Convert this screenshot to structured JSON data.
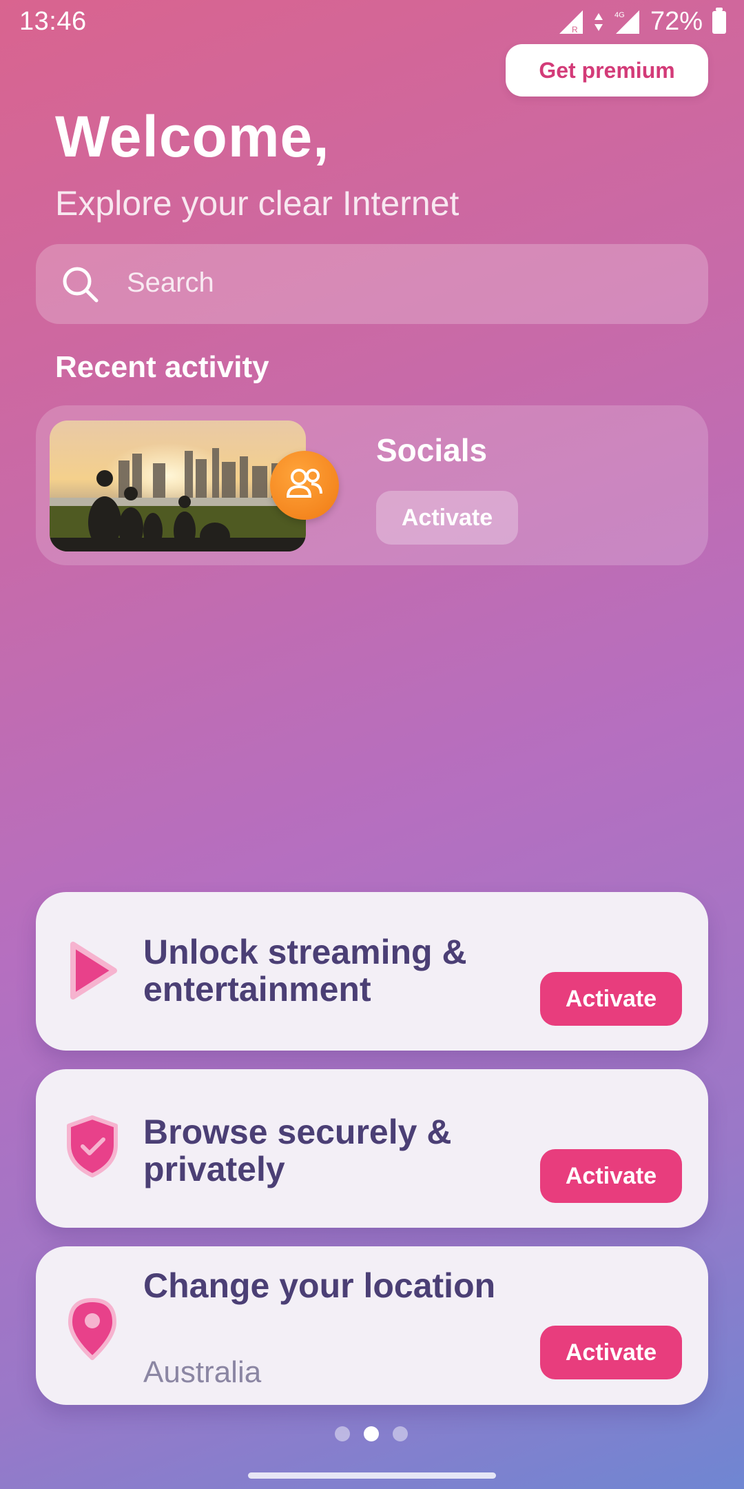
{
  "status_bar": {
    "time": "13:46",
    "battery": "72%"
  },
  "header": {
    "premium_label": "Get premium",
    "welcome": "Welcome,",
    "subtitle": "Explore your clear Internet"
  },
  "search": {
    "placeholder": "Search"
  },
  "recent": {
    "title": "Recent activity",
    "item": {
      "label": "Socials",
      "button": "Activate"
    }
  },
  "features": [
    {
      "title": "Unlock streaming & entertainment",
      "icon": "play-icon",
      "button": "Activate"
    },
    {
      "title": "Browse securely & privately",
      "icon": "shield-check-icon",
      "button": "Activate"
    },
    {
      "title": "Change your location",
      "subtitle": "Australia",
      "icon": "location-pin-icon",
      "button": "Activate"
    }
  ],
  "pagination": {
    "count": 3,
    "active_index": 1
  },
  "colors": {
    "accent": "#e83d7d",
    "card_text": "#4b3f75",
    "badge_orange": "#f07a14"
  }
}
